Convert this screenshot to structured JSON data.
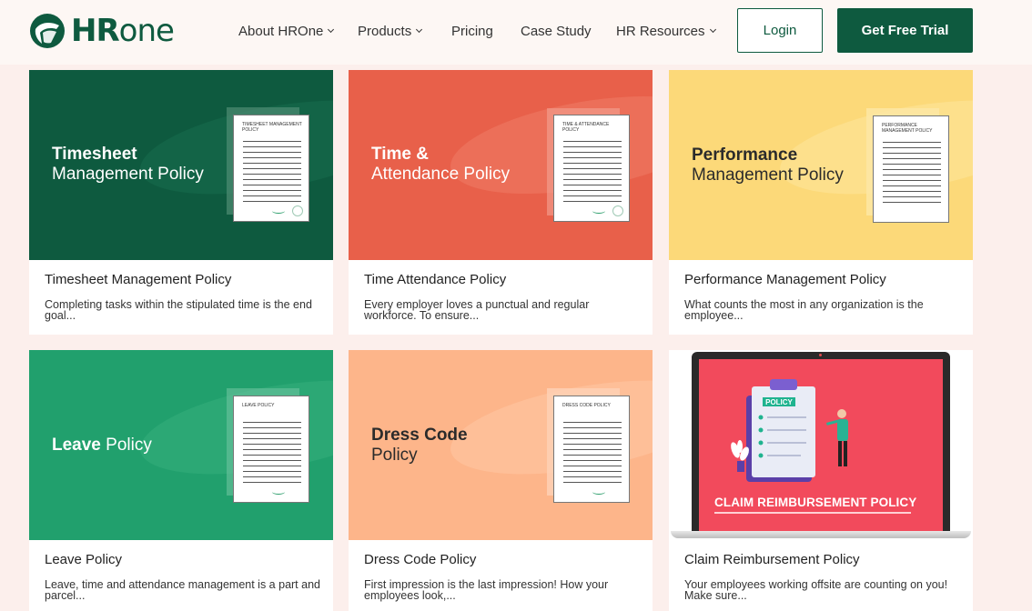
{
  "brand": {
    "logo_bold": "HR",
    "logo_rest": "one",
    "colors": {
      "primary": "#0e5a3f",
      "background": "#fcefec",
      "header": "#fdf7f4"
    }
  },
  "nav": {
    "items": [
      {
        "label": "About HROne",
        "dropdown": true
      },
      {
        "label": "Products",
        "dropdown": true
      },
      {
        "label": "Pricing",
        "dropdown": false
      },
      {
        "label": "Case Study",
        "dropdown": false
      },
      {
        "label": "HR Resources",
        "dropdown": true
      }
    ],
    "login_label": "Login",
    "trial_label": "Get Free Trial"
  },
  "cards": [
    {
      "thumb_title_bold": "Timesheet",
      "thumb_title_rest": "Management Policy",
      "doc_label": "TIMESHEET MANAGEMENT POLICY",
      "title": "Timesheet Management Policy",
      "description": "Completing tasks within the stipulated time is the end goal...",
      "theme": {
        "bg": "#0e5a3f",
        "text": "#ffffff",
        "wave": "#176b4c"
      }
    },
    {
      "thumb_title_bold": "Time &",
      "thumb_title_rest": "Attendance Policy",
      "doc_label": "TIME & ATTENDANCE POLICY",
      "title": "Time Attendance Policy",
      "description": "Every employer loves a punctual and regular workforce. To ensure...",
      "theme": {
        "bg": "#e8604a",
        "text": "#ffffff",
        "wave": "#ee7a64"
      }
    },
    {
      "thumb_title_bold": "Performance",
      "thumb_title_rest": "Management Policy",
      "doc_label": "PERFORMANCE MANAGEMENT POLICY",
      "title": "Performance Management Policy",
      "description": "What counts the most in any organization is the employee...",
      "theme": {
        "bg": "#fcd979",
        "text": "#2b2b2b",
        "wave": "#fde394"
      }
    },
    {
      "thumb_title_bold": "Leave",
      "thumb_title_rest": "Policy",
      "doc_label": "LEAVE POLICY",
      "title": "Leave Policy",
      "description": "Leave, time and attendance management is a part and parcel...",
      "theme": {
        "bg": "#21a06d",
        "text": "#ffffff",
        "wave": "#34ad7c"
      }
    },
    {
      "thumb_title_bold": "Dress Code",
      "thumb_title_rest": "Policy",
      "doc_label": "DRESS CODE POLICY",
      "title": "Dress Code Policy",
      "description": "First impression is the last impression! How your employees look,...",
      "theme": {
        "bg": "#fdb58a",
        "text": "#2b2b2b",
        "wave": "#fdc39e"
      }
    },
    {
      "claim_banner": "CLAIM REIMBURSEMENT POLICY",
      "policy_tag": "POLICY",
      "title": "Claim Reimbursement Policy",
      "description": "Your employees working offsite are counting on you! Make sure...",
      "theme": {
        "bg": "#f24a5c",
        "text": "#ffffff"
      }
    }
  ]
}
